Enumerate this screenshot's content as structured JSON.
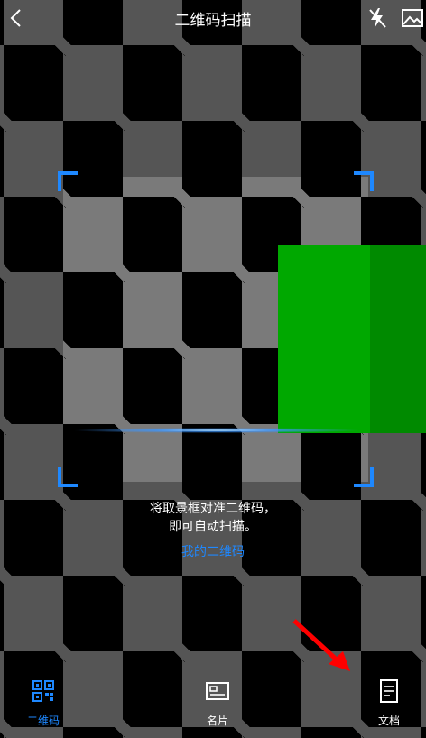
{
  "header": {
    "title": "二维码扫描",
    "back_icon": "chevron-left-icon",
    "flash_icon": "flash-off-icon",
    "gallery_icon": "image-icon"
  },
  "scanner": {
    "hint_line1": "将取景框对准二维码，",
    "hint_line2": "即可自动扫描。",
    "my_qr_link": "我的二维码",
    "accent_color": "#1e88ff"
  },
  "bottom_tabs": [
    {
      "label": "二维码",
      "icon": "qr-code-icon",
      "active": true
    },
    {
      "label": "名片",
      "icon": "business-card-icon",
      "active": false
    },
    {
      "label": "文档",
      "icon": "document-icon",
      "active": false
    }
  ],
  "annotation": {
    "arrow_color": "#ff0000",
    "arrow_icon": "red-arrow-icon"
  }
}
